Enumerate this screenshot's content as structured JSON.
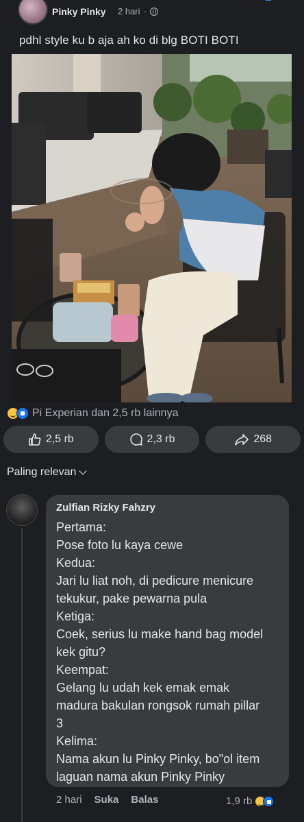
{
  "post": {
    "author": "Pinky Pinky",
    "time": "2 hari",
    "separator": "·",
    "caption": "pdhl style ku b aja ah ko di blg BOTI BOTI"
  },
  "reactions": {
    "text": "Pi Experian dan 2,5 rb lainnya",
    "icons": [
      "grinning-emoji-icon",
      "like-icon"
    ]
  },
  "actions": {
    "like": "2,5 rb",
    "comment": "2,3 rb",
    "share": "268"
  },
  "sort": {
    "label": "Paling relevan"
  },
  "comment": {
    "author": "Zulfian Rizky Fahzry",
    "lines": [
      "Pertama:",
      "Pose foto lu kaya cewe",
      "Kedua:",
      "Jari lu liat noh, di pedicure menicure",
      "tekukur, pake pewarna pula",
      "Ketiga:",
      "Coek, serius lu make hand bag model",
      "kek gitu?",
      "Keempat:",
      "Gelang lu udah kek emak emak",
      "madura bakulan rongsok rumah pillar",
      "3",
      "Kelima:",
      "Nama akun lu Pinky Pinky, bo\"ol item",
      "laguan nama akun Pinky Pinky"
    ],
    "time": "2 hari",
    "like_label": "Suka",
    "reply_label": "Balas",
    "reaction_count": "1,9 rb"
  },
  "colors": {
    "background": "#1c1e21",
    "bubble": "#3a3b3c",
    "accent": "#1877f2"
  }
}
